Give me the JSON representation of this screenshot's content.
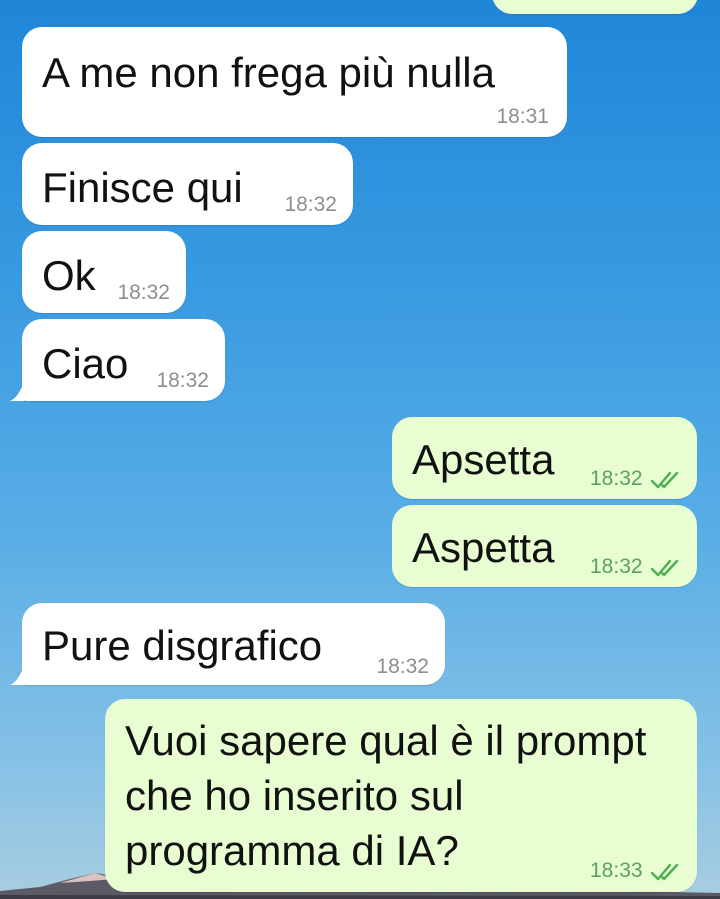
{
  "app": {
    "background_top_color": "#1f86d8",
    "incoming_bubble_color": "#ffffff",
    "outgoing_bubble_color": "#e8fdd2",
    "tick_color": "#4caf50"
  },
  "messages": [
    {
      "direction": "incoming",
      "text": "A me non frega più nulla",
      "time": "18:31"
    },
    {
      "direction": "incoming",
      "text": "Finisce qui",
      "time": "18:32"
    },
    {
      "direction": "incoming",
      "text": "Ok",
      "time": "18:32"
    },
    {
      "direction": "incoming",
      "text": "Ciao",
      "time": "18:32"
    },
    {
      "direction": "outgoing",
      "text": "Apsetta",
      "time": "18:32",
      "status_icon": "double-check-icon"
    },
    {
      "direction": "outgoing",
      "text": "Aspetta",
      "time": "18:32",
      "status_icon": "double-check-icon"
    },
    {
      "direction": "incoming",
      "text": "Pure disgrafico",
      "time": "18:32"
    },
    {
      "direction": "outgoing",
      "text": "Vuoi sapere qual è il prompt che ho inserito sul programma di IA?",
      "time": "18:33",
      "status_icon": "double-check-icon"
    }
  ]
}
